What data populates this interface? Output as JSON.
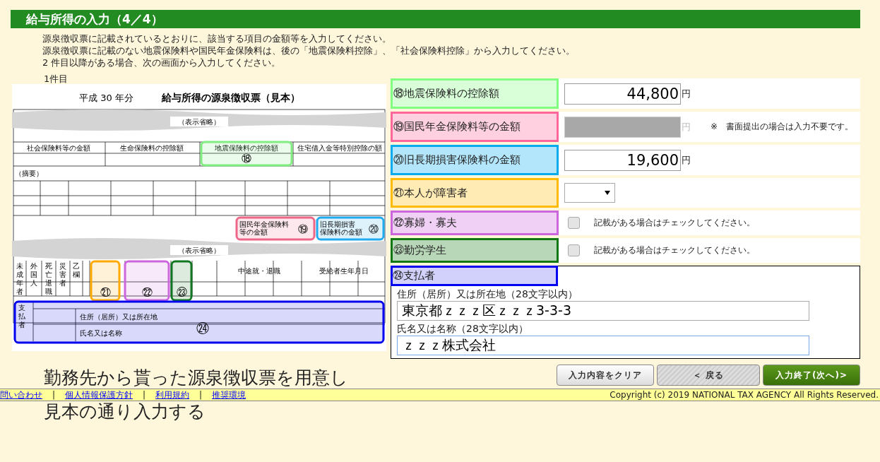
{
  "header": {
    "title": "給与所得の入力（4／4）"
  },
  "instructions": [
    "源泉徴収票に記載されているとおりに、該当する項目の金額等を入力してください。",
    "源泉徴収票に記載のない地震保険料や国民年金保険料は、後の「地震保険料控除」、「社会保険料控除」から入力してください。",
    "2 件目以降がある場合、次の画面から入力してください。"
  ],
  "entry_label": "1件目",
  "sample": {
    "year": "平成 30 年分",
    "title": "給与所得の源泉徴収票（見本）",
    "omitted": [
      "（表示省略）",
      "（表示省略）"
    ],
    "columns": [
      "社会保険料等の金額",
      "生命保険料の控除額",
      "地震保険料の控除額",
      "住宅借入金等特別控除の額"
    ],
    "remarks": "（摘要）",
    "box_labels": [
      "国民年金保険料等の金額",
      "旧長期損害保険料の金額"
    ],
    "bottom_headers": [
      "未成年者",
      "外国人",
      "死亡退職",
      "災害者",
      "乙欄"
    ],
    "retire": "中途就・退職",
    "birth": "受給者生年月日",
    "payer_side": "支払者",
    "payer_address": "住所（居所）又は所在地",
    "payer_name": "氏名又は名称",
    "markers": [
      {
        "number": "⑱",
        "color": "#80ee80"
      },
      {
        "number": "⑲",
        "color": "#ee6688"
      },
      {
        "number": "⑳",
        "color": "#22aaee"
      },
      {
        "number": "㉑",
        "color": "#ffaa00"
      },
      {
        "number": "㉒",
        "color": "#cc66dd"
      },
      {
        "number": "㉓",
        "color": "#117722"
      },
      {
        "number": "㉔",
        "color": "#0000ee"
      }
    ]
  },
  "fields": [
    {
      "kind": "amount",
      "label": "⑱地震保険料の控除額",
      "color": "#80ff80",
      "value": "44,800",
      "unit": "円",
      "disabled": false
    },
    {
      "kind": "amount",
      "label": "⑲国民年金保険料等の金額",
      "color": "#ff6699",
      "unit": "円",
      "disabled": true,
      "note": "※　書面提出の場合は入力不要です。"
    },
    {
      "kind": "amount",
      "label": "⑳旧長期損害保険料の金額",
      "color": "#00aaee",
      "value": "19,600",
      "unit": "円",
      "disabled": false
    },
    {
      "kind": "select",
      "label": "㉑本人が障害者",
      "color": "#ffbb00"
    },
    {
      "kind": "check",
      "label": "㉒寡婦・寡夫",
      "color": "#cc66dd",
      "checked": false,
      "note": "記載がある場合はチェックしてください。"
    },
    {
      "kind": "check",
      "label": "㉓勤労学生",
      "color": "#117711",
      "checked": false,
      "note": "記載がある場合はチェックしてください。"
    },
    {
      "kind": "payer",
      "label": "㉔支払者",
      "color": "#0000ee",
      "inputs": [
        {
          "label": "住所（居所）又は所在地（28文字以内）",
          "value": "東京都ｚｚｚ区ｚｚｚ3-3-3",
          "focused": false
        },
        {
          "label": "氏名又は名称（28文字以内）",
          "value": "ｚｚｚ株式会社",
          "focused": true
        }
      ]
    }
  ],
  "buttons": [
    {
      "kind": "clear",
      "label": "入力内容をクリア"
    },
    {
      "kind": "back",
      "label": "＜ 戻る"
    },
    {
      "kind": "next",
      "label": "入力終了(次へ)>"
    }
  ],
  "captions": [
    "勤務先から貰った源泉徴収票を用意し",
    "見本の通り入力する"
  ],
  "footer": {
    "links": [
      "問い合わせ",
      "個人情報保護方針",
      "利用規約",
      "推奨環境"
    ],
    "separator": "|",
    "copyright": "Copyright (c) 2019 NATIONAL TAX AGENCY All Rights Reserved."
  }
}
